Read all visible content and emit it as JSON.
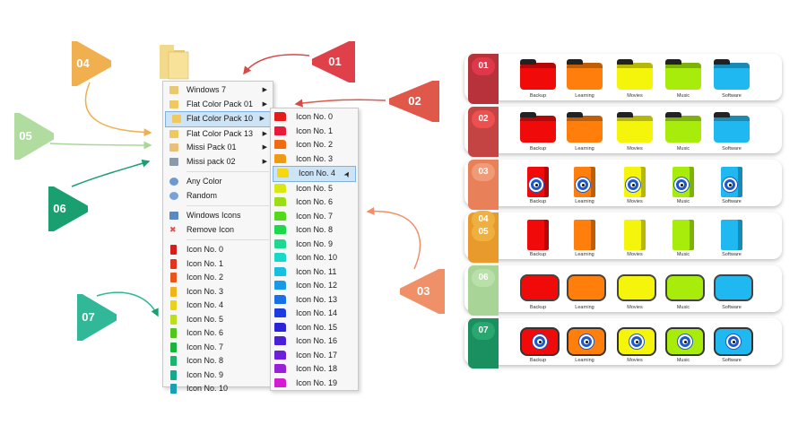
{
  "main_menu": {
    "items": [
      {
        "label": "Windows 7",
        "icon": "small-folder-icon",
        "arrow": true
      },
      {
        "label": "Flat Color Pack 01",
        "icon": "small-folder-icon",
        "arrow": true
      },
      {
        "label": "Flat Color Pack 10",
        "icon": "small-folder-icon",
        "arrow": true,
        "highlighted": true
      },
      {
        "label": "Flat Color Pack 13",
        "icon": "small-folder-icon",
        "arrow": true
      },
      {
        "label": "Missi Pack 01",
        "icon": "small-folder-icon",
        "arrow": true
      },
      {
        "label": "Missi pack 02",
        "icon": "small-folder-icon",
        "arrow": true
      }
    ],
    "actions": [
      {
        "label": "Any Color",
        "icon": "color-icon"
      },
      {
        "label": "Random",
        "icon": "random-icon"
      }
    ],
    "actions2": [
      {
        "label": "Windows Icons",
        "icon": "windows-icon"
      },
      {
        "label": "Remove Icon",
        "icon": "remove-icon"
      }
    ],
    "icon_list": [
      "Icon No. 0",
      "Icon No. 1",
      "Icon No. 2",
      "Icon No. 3",
      "Icon No. 4",
      "Icon No. 5",
      "Icon No. 6",
      "Icon No. 7",
      "Icon No. 8",
      "Icon No. 9",
      "Icon No. 10"
    ],
    "icon_colors": [
      "#d41f1f",
      "#e0341c",
      "#e8571a",
      "#f0b41a",
      "#e8d21c",
      "#bde01c",
      "#55c41c",
      "#1cb43c",
      "#1cb46e",
      "#18a88c",
      "#1aa0b4"
    ]
  },
  "sub_menu": {
    "items": [
      "Icon No. 0",
      "Icon No. 1",
      "Icon No. 2",
      "Icon No. 3",
      "Icon No. 4",
      "Icon No. 5",
      "Icon No. 6",
      "Icon No. 7",
      "Icon No. 8",
      "Icon No. 9",
      "Icon No. 10",
      "Icon No. 11",
      "Icon No. 12",
      "Icon No. 13",
      "Icon No. 14",
      "Icon No. 15",
      "Icon No. 16",
      "Icon No. 17",
      "Icon No. 18",
      "Icon No. 19"
    ],
    "colors": [
      "#e41c1c",
      "#e81c3a",
      "#f06a12",
      "#f09a12",
      "#f5d80e",
      "#d8e812",
      "#9cde14",
      "#54d81c",
      "#1cd84a",
      "#1cd890",
      "#18d8c8",
      "#18c0e0",
      "#189ae8",
      "#1870e8",
      "#1a3ce0",
      "#2a24d8",
      "#4a20d8",
      "#6c20d8",
      "#9a20d8",
      "#d41cd0"
    ],
    "highlighted_index": 4
  },
  "panel": {
    "labels": [
      "Backup",
      "Learning",
      "Movies",
      "Music",
      "Software"
    ],
    "folder_colors": [
      "#f00a0a",
      "#ff7e0c",
      "#f5f50c",
      "#a8ec0c",
      "#20b8f0"
    ],
    "rows": [
      {
        "num": "01",
        "strip": "#b8323c",
        "pill": "#e0384a",
        "style": "folder"
      },
      {
        "num": "02",
        "strip": "#c44444",
        "pill": "#ee5050",
        "style": "folder"
      },
      {
        "num": "03",
        "strip": "#e8805a",
        "pill": "#f09a78",
        "style": "book"
      },
      {
        "num": "04",
        "num2": "05",
        "strip": "#e89a2c",
        "pill": "#f0b040",
        "style": "book2"
      },
      {
        "num": "06",
        "strip": "#a8d498",
        "pill": "#b8e0a8",
        "style": "folder2"
      },
      {
        "num": "07",
        "strip": "#1a9060",
        "pill": "#28a870",
        "style": "eye"
      }
    ]
  },
  "callouts": [
    {
      "num": "01",
      "color": "#e0404a"
    },
    {
      "num": "02",
      "color": "#e0584a"
    },
    {
      "num": "03",
      "color": "#f09068"
    },
    {
      "num": "04",
      "color": "#f0b050"
    },
    {
      "num": "05",
      "color": "#b0dca0"
    },
    {
      "num": "06",
      "color": "#1aa070"
    },
    {
      "num": "07",
      "color": "#30b898"
    }
  ]
}
